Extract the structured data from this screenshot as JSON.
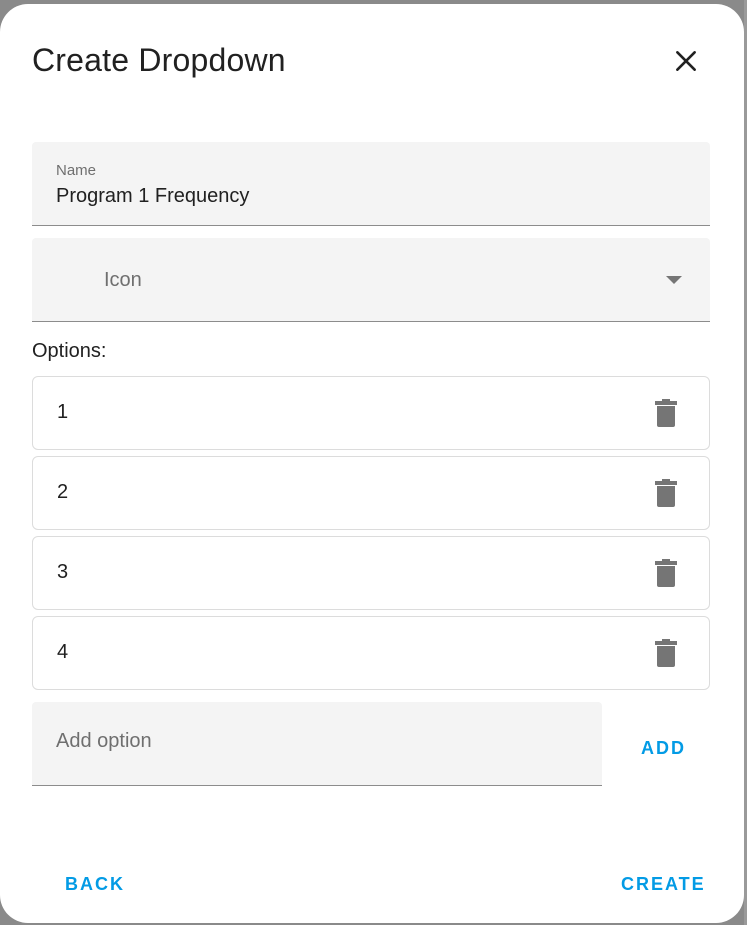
{
  "dialog": {
    "title": "Create Dropdown",
    "close_icon": "close-icon"
  },
  "name_field": {
    "label": "Name",
    "value": "Program 1 Frequency"
  },
  "icon_field": {
    "label": "Icon",
    "arrow_icon": "caret-down-icon"
  },
  "options": {
    "label": "Options:",
    "items": [
      {
        "value": "1",
        "delete_icon": "trash-icon"
      },
      {
        "value": "2",
        "delete_icon": "trash-icon"
      },
      {
        "value": "3",
        "delete_icon": "trash-icon"
      },
      {
        "value": "4",
        "delete_icon": "trash-icon"
      }
    ]
  },
  "add_option": {
    "placeholder": "Add option",
    "button_label": "ADD"
  },
  "footer": {
    "back_label": "BACK",
    "create_label": "CREATE"
  },
  "colors": {
    "accent": "#039be5",
    "field_bg": "#f4f4f4",
    "icon_gray": "#757575"
  }
}
